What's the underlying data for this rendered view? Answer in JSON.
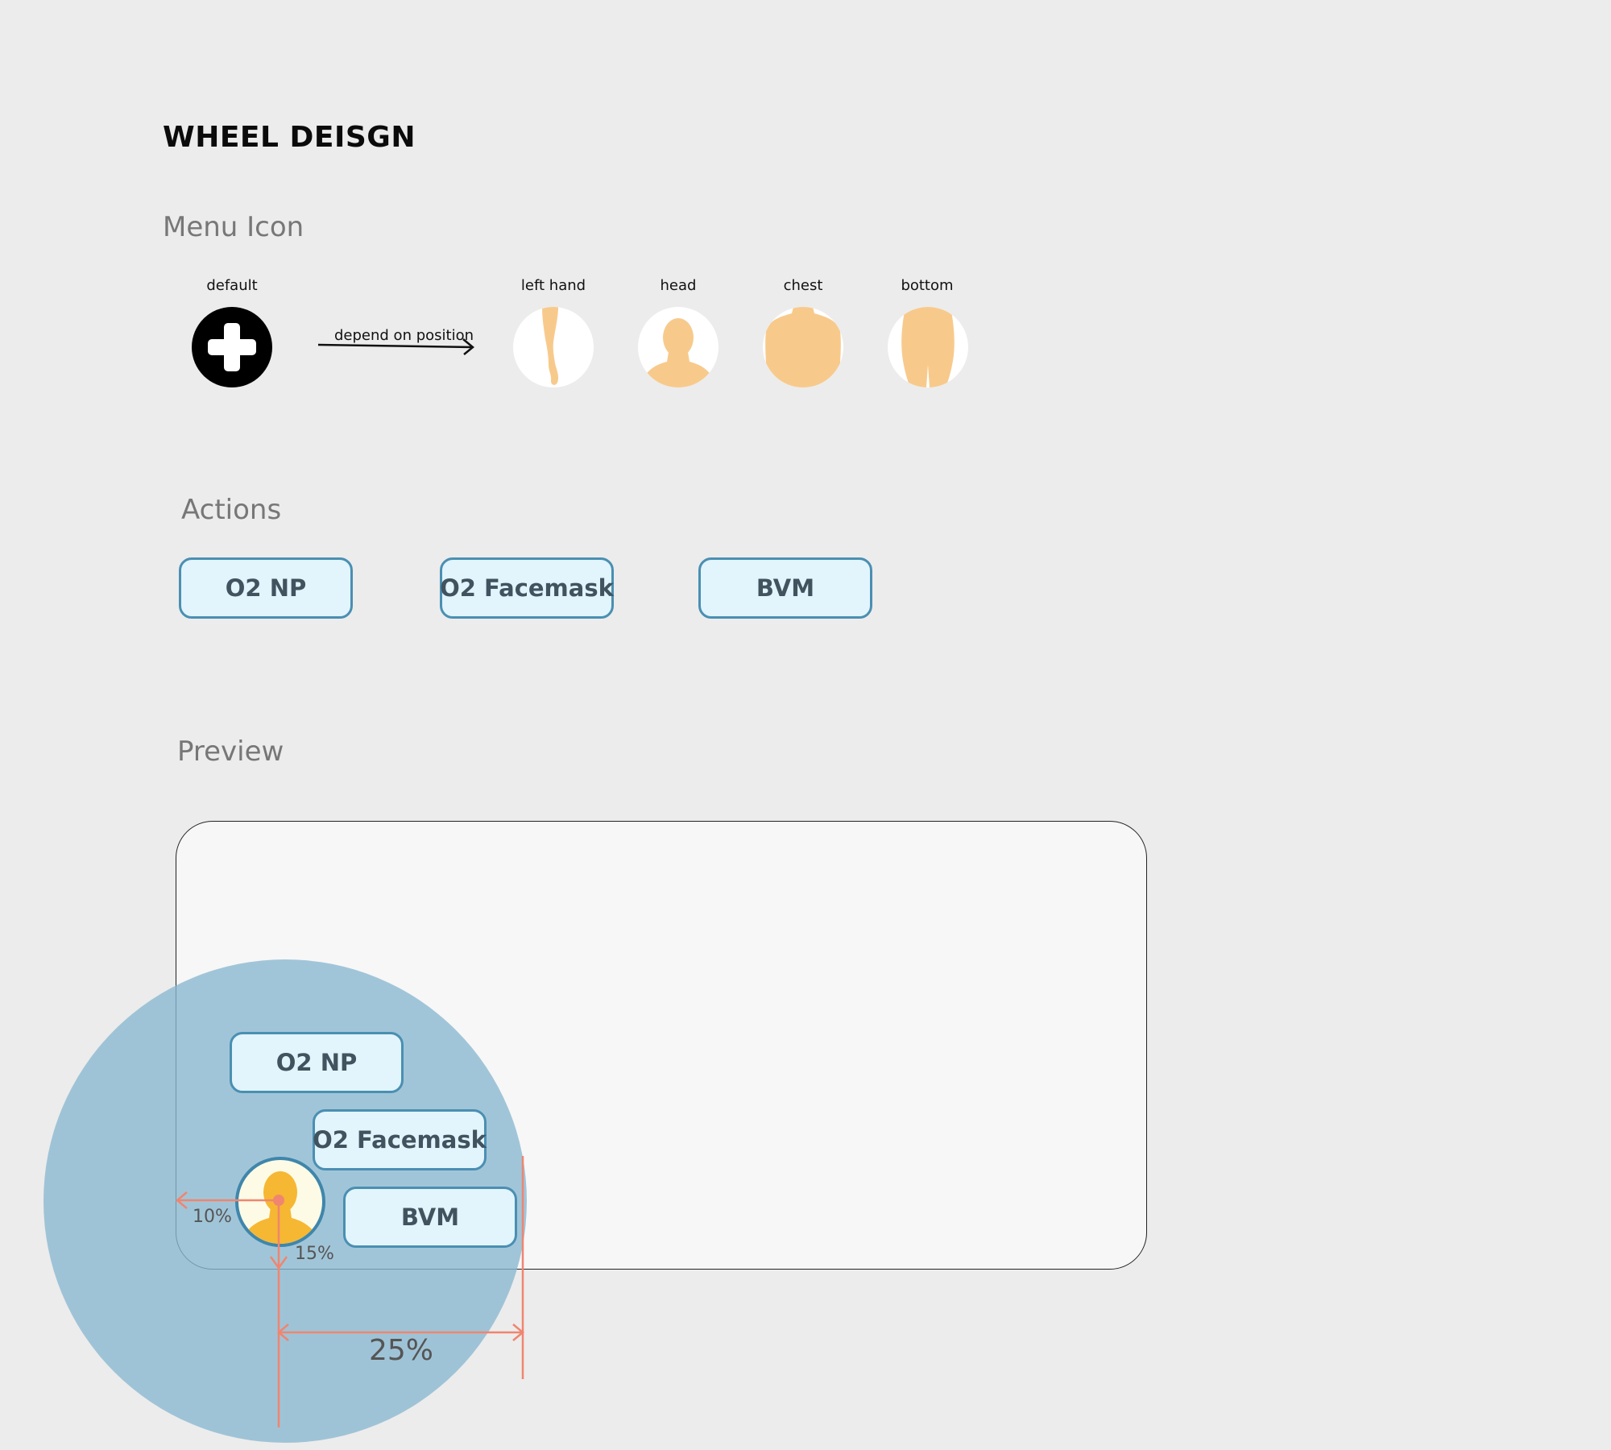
{
  "title": "WHEEL DEISGN",
  "sections": {
    "menu_icon": "Menu Icon",
    "actions": "Actions",
    "preview": "Preview"
  },
  "menu_icons": {
    "default_label": "default",
    "arrow_label": "depend on position",
    "positions": [
      {
        "label": "left hand",
        "icon": "arm-icon"
      },
      {
        "label": "head",
        "icon": "head-icon"
      },
      {
        "label": "chest",
        "icon": "chest-icon"
      },
      {
        "label": "bottom",
        "icon": "bottom-icon"
      }
    ]
  },
  "actions": [
    {
      "label": "O2 NP"
    },
    {
      "label": "O2 Facemask"
    },
    {
      "label": "BVM"
    }
  ],
  "preview": {
    "actions": [
      {
        "label": "O2 NP"
      },
      {
        "label": "O2 Facemask"
      },
      {
        "label": "BVM"
      }
    ],
    "measurements": {
      "left_offset": "10%",
      "bottom_offset": "15%",
      "radius": "25%"
    }
  },
  "colors": {
    "skin": "#f7ca8c",
    "button_fill": "#e2f4fc",
    "button_border": "#4a8fb2",
    "wheel": "#89b7cf",
    "measure": "#f08570",
    "avatar": "#f6b732"
  }
}
